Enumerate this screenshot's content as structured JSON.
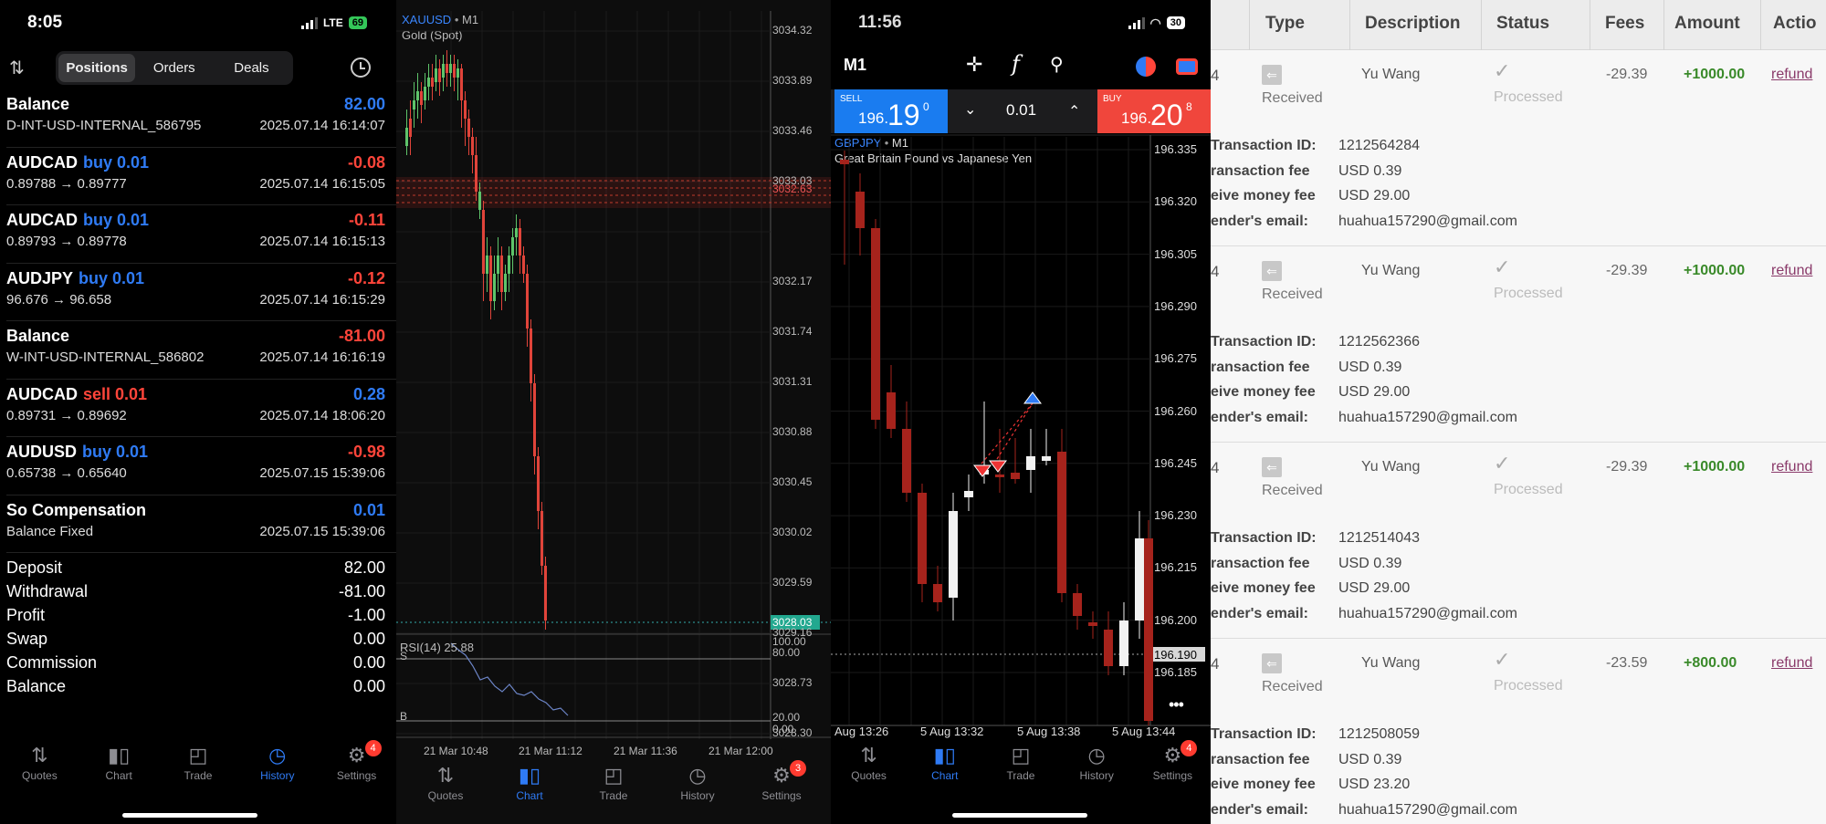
{
  "p1": {
    "time": "8:05",
    "network": "LTE",
    "battery": "69",
    "tabs": [
      "Positions",
      "Orders",
      "Deals"
    ],
    "rows": [
      {
        "sym": "Balance",
        "action": "",
        "val": "82.00",
        "val_class": "pos",
        "sub": "D-INT-USD-INTERNAL_586795",
        "date": "2025.07.14 16:14:07"
      },
      {
        "sym": "AUDCAD",
        "action": "buy 0.01",
        "val": "-0.08",
        "val_class": "neg",
        "sub": "0.89788 → 0.89777",
        "date": "2025.07.14 16:15:05"
      },
      {
        "sym": "AUDCAD",
        "action": "buy 0.01",
        "val": "-0.11",
        "val_class": "neg",
        "sub": "0.89793 → 0.89778",
        "date": "2025.07.14 16:15:13"
      },
      {
        "sym": "AUDJPY",
        "action": "buy 0.01",
        "val": "-0.12",
        "val_class": "neg",
        "sub": "96.676 → 96.658",
        "date": "2025.07.14 16:15:29"
      },
      {
        "sym": "Balance",
        "action": "",
        "val": "-81.00",
        "val_class": "neg",
        "sub": "W-INT-USD-INTERNAL_586802",
        "date": "2025.07.14 16:16:19"
      },
      {
        "sym": "AUDCAD",
        "action": "sell 0.01",
        "val": "0.28",
        "val_class": "pos",
        "sub": "0.89731 → 0.89692",
        "date": "2025.07.14 18:06:20"
      },
      {
        "sym": "AUDUSD",
        "action": "buy 0.01",
        "val": "-0.98",
        "val_class": "neg",
        "sub": "0.65738 → 0.65640",
        "date": "2025.07.15 15:39:06"
      },
      {
        "sym": "So Compensation",
        "action": "",
        "val": "0.01",
        "val_class": "pos",
        "sub": "Balance Fixed",
        "date": "2025.07.15 15:39:06"
      }
    ],
    "summary": [
      {
        "label": "Deposit",
        "value": "82.00"
      },
      {
        "label": "Withdrawal",
        "value": "-81.00"
      },
      {
        "label": "Profit",
        "value": "-1.00"
      },
      {
        "label": "Swap",
        "value": "0.00"
      },
      {
        "label": "Commission",
        "value": "0.00"
      },
      {
        "label": "Balance",
        "value": "0.00"
      }
    ],
    "nav": [
      "Quotes",
      "Chart",
      "Trade",
      "History",
      "Settings"
    ],
    "settings_badge": "4",
    "active_nav": "History"
  },
  "p2": {
    "symbol": "XAUUSD",
    "timeframe": "M1",
    "description": "Gold (Spot)",
    "price_ticks": [
      "3034.32",
      "3033.89",
      "3033.46",
      "3033.03",
      "3032.63",
      "3032.17",
      "3031.74",
      "3031.31",
      "3030.88",
      "3030.45",
      "3030.02",
      "3029.59",
      "3029.16",
      "3028.73",
      "3028.30"
    ],
    "last_price": "3028.03",
    "indicator": "RSI(14) 25.88",
    "rsi_ticks": [
      "100.00",
      "80.00",
      "20.00",
      "0.00"
    ],
    "s_label": "S",
    "b_label": "B",
    "time_ticks": [
      "21 Mar 10:48",
      "21 Mar 11:12",
      "21 Mar 11:36",
      "21 Mar 12:00"
    ],
    "nav": [
      "Quotes",
      "Chart",
      "Trade",
      "History",
      "Settings"
    ],
    "settings_badge": "3",
    "active_nav": "Chart"
  },
  "p3": {
    "time": "11:56",
    "battery": "30",
    "timeframe": "M1",
    "sell_label": "SELL",
    "sell_price_small": "196.",
    "sell_price_big": "19",
    "sell_price_sup": "0",
    "lot": "0.01",
    "buy_label": "BUY",
    "buy_price_small": "196.",
    "buy_price_big": "20",
    "buy_price_sup": "8",
    "symbol": "GBPJPY",
    "chart_tf": "M1",
    "description": "Great Britain Pound vs Japanese Yen",
    "price_ticks": [
      "196.335",
      "196.320",
      "196.305",
      "196.290",
      "196.275",
      "196.260",
      "196.245",
      "196.230",
      "196.215",
      "196.200",
      "196.185"
    ],
    "current_price": "196.190",
    "time_ticks": [
      "Aug 13:26",
      "5 Aug 13:32",
      "5 Aug 13:38",
      "5 Aug 13:44"
    ],
    "nav": [
      "Quotes",
      "Chart",
      "Trade",
      "History",
      "Settings"
    ],
    "settings_badge": "4",
    "active_nav": "Chart"
  },
  "p4": {
    "headers": [
      "Type",
      "Description",
      "Status",
      "Fees",
      "Amount",
      "Actio"
    ],
    "detail_labels": [
      "Transaction ID:",
      "ransaction fee",
      "eive money fee",
      "ender's email:"
    ],
    "records": [
      {
        "id_prefix": "4",
        "type": "Received",
        "desc": "Yu Wang",
        "status": "Processed",
        "fees": "-29.39",
        "amount": "+1000.00",
        "action": "refund",
        "tid": "1212564284",
        "tfee": "USD 0.39",
        "rfee": "USD 29.00",
        "email": "huahua157290@gmail.com"
      },
      {
        "id_prefix": "4",
        "type": "Received",
        "desc": "Yu Wang",
        "status": "Processed",
        "fees": "-29.39",
        "amount": "+1000.00",
        "action": "refund",
        "tid": "1212562366",
        "tfee": "USD 0.39",
        "rfee": "USD 29.00",
        "email": "huahua157290@gmail.com"
      },
      {
        "id_prefix": "4",
        "type": "Received",
        "desc": "Yu Wang",
        "status": "Processed",
        "fees": "-29.39",
        "amount": "+1000.00",
        "action": "refund",
        "tid": "1212514043",
        "tfee": "USD 0.39",
        "rfee": "USD 29.00",
        "email": "huahua157290@gmail.com"
      },
      {
        "id_prefix": "4",
        "type": "Received",
        "desc": "Yu Wang",
        "status": "Processed",
        "fees": "-23.59",
        "amount": "+800.00",
        "action": "refund",
        "tid": "1212508059",
        "tfee": "USD 0.39",
        "rfee": "USD 23.20",
        "email": "huahua157290@gmail.com"
      }
    ]
  }
}
